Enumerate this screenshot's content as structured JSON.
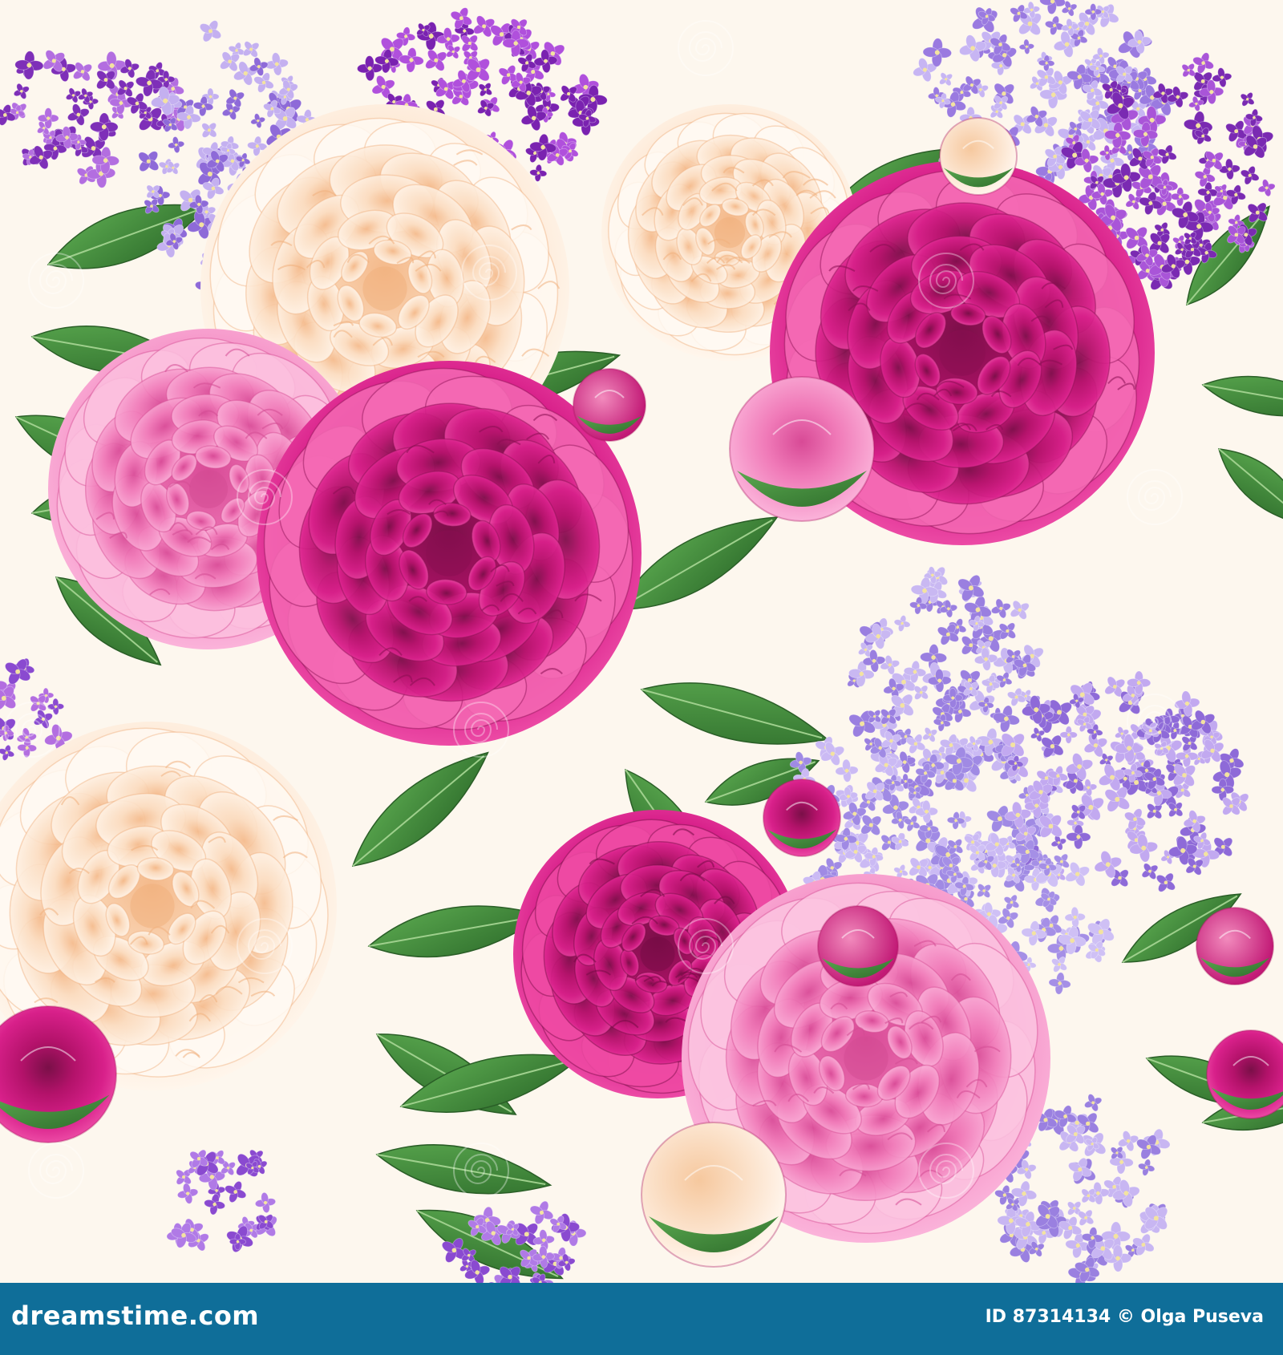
{
  "footer": {
    "brand": "dreamstime.com",
    "credit": "ID 87314134 © Olga Puseva"
  },
  "colors": {
    "background": "#fdf7ee",
    "footer_bar": "#0f6e99",
    "magenta_peony": "#c8157a",
    "pink_peony": "#f07ab8",
    "cream_peony": "#fde6cf",
    "lilac": "#b79be8",
    "purple_lilac": "#9b3fd0",
    "leaf": "#3f8a3a"
  },
  "watermark": {
    "icon": "dreamstime-swirl-icon"
  }
}
